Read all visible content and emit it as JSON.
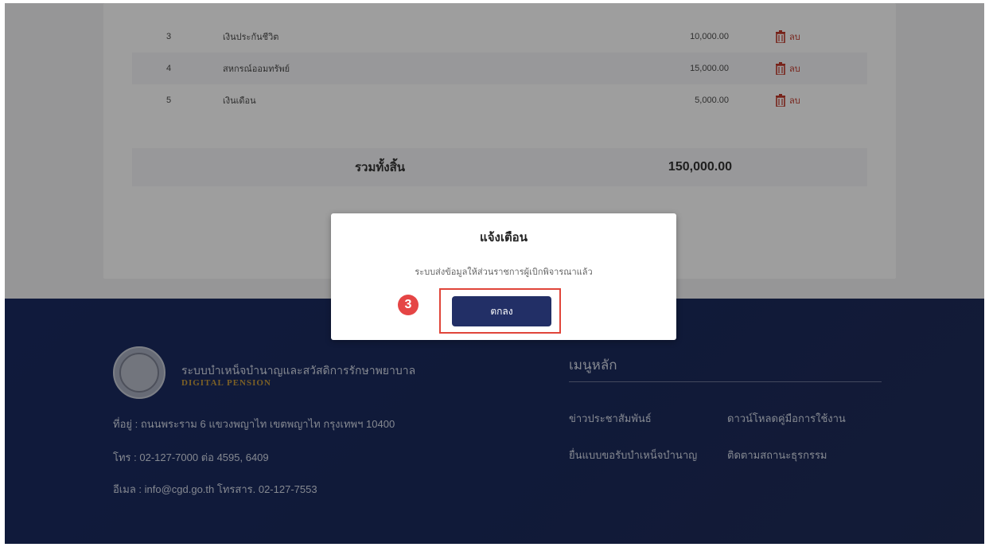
{
  "table": {
    "rows": [
      {
        "no": "3",
        "name": "เงินประกันชีวิต",
        "amount": "10,000.00",
        "delete_label": "ลบ"
      },
      {
        "no": "4",
        "name": "สหกรณ์ออมทรัพย์",
        "amount": "15,000.00",
        "delete_label": "ลบ"
      },
      {
        "no": "5",
        "name": "เงินเดือน",
        "amount": "5,000.00",
        "delete_label": "ลบ"
      }
    ],
    "total_label": "รวมทั้งสิ้น",
    "total_value": "150,000.00"
  },
  "footer": {
    "org_name": "ระบบบำเหน็จบำนาญและสวัสดิการรักษาพยาบาล",
    "org_sub": "DIGITAL PENSION",
    "address": "ที่อยู่ : ถนนพระราม 6 แขวงพญาไท เขตพญาไท กรุงเทพฯ 10400",
    "phone": "โทร : 02-127-7000 ต่อ 4595, 6409",
    "email": "อีเมล : info@cgd.go.th โทรสาร. 02-127-7553",
    "menu_title": "เมนูหลัก",
    "menu_links": [
      "ข่าวประชาสัมพันธ์",
      "ดาวน์โหลดคู่มือการใช้งาน",
      "ยื่นแบบขอรับบำเหน็จบำนาญ",
      "ติดตามสถานะธุรกรรม"
    ]
  },
  "modal": {
    "title": "แจ้งเตือน",
    "message": "ระบบส่งข้อมูลให้ส่วนราชการผู้เบิกพิจารณาแล้ว",
    "ok_label": "ตกลง",
    "step_number": "3"
  },
  "colors": {
    "footer_bg": "#1b2a5c",
    "primary_button": "#222f66",
    "highlight_red": "#e0453a",
    "delete_red": "#c0392b"
  }
}
